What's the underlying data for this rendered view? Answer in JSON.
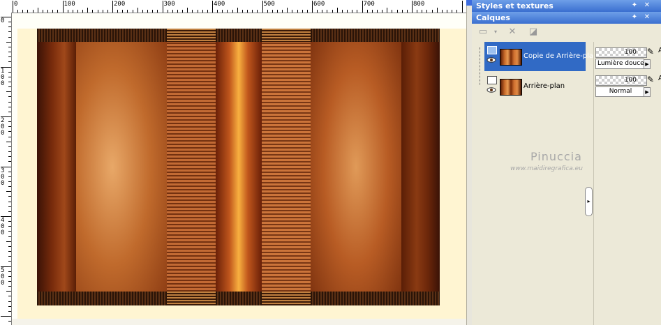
{
  "canvas": {
    "ruler_top_labels": [
      "0",
      "100",
      "200",
      "300",
      "400",
      "500",
      "600",
      "700",
      "800"
    ],
    "ruler_left_labels": [
      "0",
      "1\n0\n0",
      "2\n0\n0",
      "3\n0\n0",
      "4\n0\n0",
      "5\n0\n0"
    ]
  },
  "panels": {
    "styles_title": "Styles et textures",
    "layers_title": "Calques"
  },
  "layers": [
    {
      "name": "Copie de Arrière-plan",
      "opacity": "100",
      "blend": "Lumière douce",
      "selected": true
    },
    {
      "name": "Arrière-plan",
      "opacity": "100",
      "blend": "Normal",
      "selected": false
    }
  ],
  "props_cut_label": "A",
  "watermark": {
    "name": "Pinuccia",
    "url": "www.maidiregrafica.eu"
  },
  "icons": {
    "pin": "pin-icon",
    "close": "close-icon",
    "new_layer": "new-layer-icon",
    "delete_layer": "delete-layer-icon",
    "eye": "eye-icon",
    "brush": "brush-icon"
  },
  "colors": {
    "title_bar": "#3a6fd0",
    "selection": "#316ac5",
    "image_dark": "#3a1206",
    "image_light": "#e8a060"
  }
}
